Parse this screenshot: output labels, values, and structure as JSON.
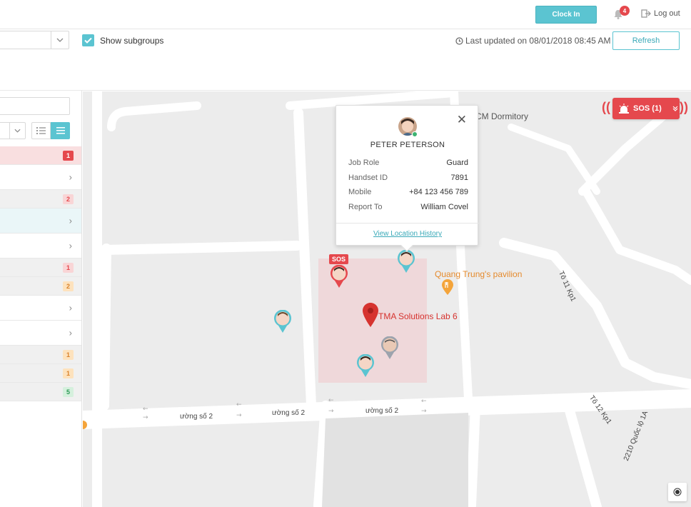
{
  "header": {
    "clock_in_label": "Clock In",
    "notifications_count": "4",
    "logout_label": "Log out"
  },
  "filters": {
    "show_subgroups_label": "Show subgroups",
    "show_subgroups_checked": true,
    "last_updated": "Last updated on 08/01/2018 08:45 AM",
    "refresh_label": "Refresh"
  },
  "sidebar": {
    "rows": [
      {
        "badge": "1",
        "status": "sos"
      },
      {
        "chevron": "›"
      },
      {
        "badge": "2",
        "status": "sos-light"
      },
      {
        "chevron": "›"
      },
      {
        "chevron": "›"
      },
      {
        "badge": "1",
        "status": "sos-light"
      },
      {
        "badge": "2",
        "status": "warning"
      },
      {
        "chevron": "›"
      },
      {
        "chevron": "›"
      },
      {
        "badge": "1",
        "status": "warning"
      },
      {
        "badge": "1",
        "status": "warning"
      },
      {
        "badge": "5",
        "status": "ok"
      }
    ]
  },
  "map": {
    "dormitory_label": "CM Dormitory",
    "pavilion_label": "Quang Trung's pavilion",
    "lab_label": "TMA Solutions Lab 6",
    "street_labels": [
      "ường số 2",
      "ường số 2",
      "ường số 2"
    ],
    "road_label_1": "Tô 11 Kp1",
    "road_label_2": "Tô 12 Kp1",
    "road_label_3": "2210 Quốc lộ 1A",
    "sos_tag": "SOS"
  },
  "popup": {
    "name": "PETER PETERSON",
    "fields": [
      {
        "key": "Job Role",
        "value": "Guard"
      },
      {
        "key": "Handset ID",
        "value": "7891"
      },
      {
        "key": "Mobile",
        "value": "+84 123 456 789"
      },
      {
        "key": "Report To",
        "value": "William Covel"
      }
    ],
    "history_link": "View Location History",
    "close_glyph": "✕"
  },
  "sos_button": {
    "label": "SOS (1)"
  },
  "colors": {
    "accent": "#5bc4d1",
    "sos": "#e5484d",
    "warning": "#f4a43a",
    "ok": "#3cb371"
  }
}
